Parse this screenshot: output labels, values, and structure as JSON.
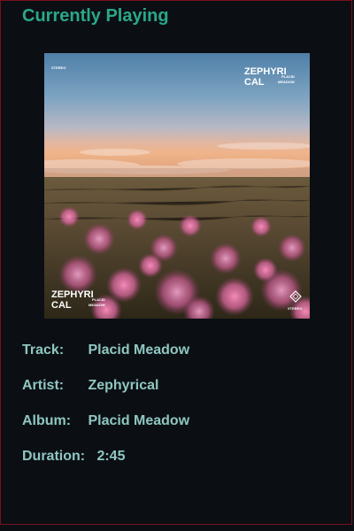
{
  "header": {
    "title": "Currently Playing"
  },
  "album_art": {
    "logo_top_line1": "ZEPHYRI",
    "logo_top_line2": "CAL",
    "logo_top_sub1": "PLACID",
    "logo_top_sub2": "MEADOW",
    "logo_bottom_line1": "ZEPHYRI",
    "logo_bottom_line2": "CAL",
    "logo_bottom_sub1": "PLACID",
    "logo_bottom_sub2": "MEADOW",
    "label_top_left": "XTEREO",
    "label_bottom_right": "XTEREO"
  },
  "track_info": {
    "track_label": "Track:",
    "track_value": "Placid Meadow",
    "artist_label": "Artist:",
    "artist_value": "Zephyrical",
    "album_label": "Album:",
    "album_value": "Placid Meadow",
    "duration_label": "Duration:",
    "duration_value": "2:45"
  },
  "colors": {
    "background": "#0b0f14",
    "border": "#7a0f1a",
    "title": "#2aa889",
    "text": "#8fc7c0"
  }
}
